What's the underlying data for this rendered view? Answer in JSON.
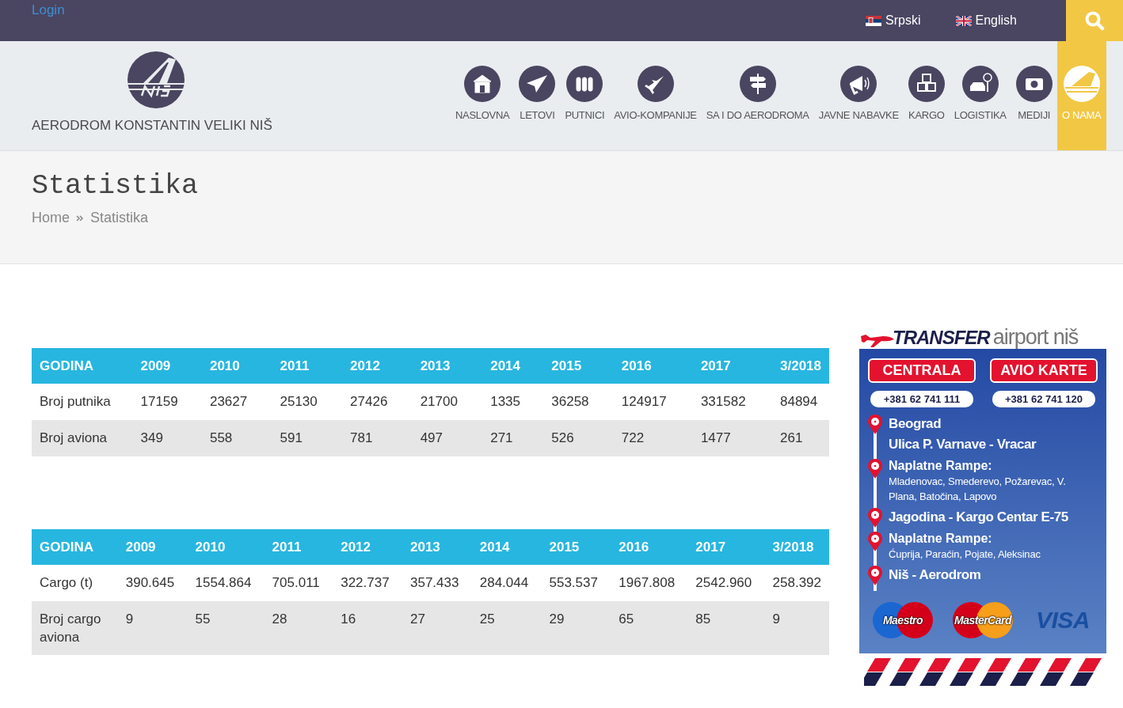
{
  "top_bar": {
    "login": "Login",
    "languages": [
      {
        "label": "Srpski"
      },
      {
        "label": "English"
      }
    ]
  },
  "header": {
    "site_name": "AERODROM KONSTANTIN VELIKI NIŠ",
    "nav": [
      {
        "label": "NASLOVNA",
        "selected": false
      },
      {
        "label": "LETOVI",
        "selected": false
      },
      {
        "label": "PUTNICI",
        "selected": false
      },
      {
        "label": "AVIO-KOMPANIJE",
        "selected": false
      },
      {
        "label": "SA I DO AERODROMA",
        "selected": false
      },
      {
        "label": "JAVNE NABAVKE",
        "selected": false
      },
      {
        "label": "KARGO",
        "selected": false
      },
      {
        "label": "LOGISTIKA",
        "selected": false
      },
      {
        "label": "MEDIJI",
        "selected": false
      },
      {
        "label": "O NAMA",
        "selected": true
      }
    ]
  },
  "page_header": {
    "title": "Statistika",
    "breadcrumb": [
      "Home",
      "Statistika"
    ]
  },
  "tables": [
    {
      "columns": [
        "GODINA",
        "2009",
        "2010",
        "2011",
        "2012",
        "2013",
        "2014",
        "2015",
        "2016",
        "2017",
        "3/2018"
      ],
      "rows": [
        [
          "Broj putnika",
          "17159",
          "23627",
          "25130",
          "27426",
          "21700",
          "1335",
          "36258",
          "124917",
          "331582",
          "84894"
        ],
        [
          "Broj aviona",
          "349",
          "558",
          "591",
          "781",
          "497",
          "271",
          "526",
          "722",
          "1477",
          "261"
        ]
      ]
    },
    {
      "columns": [
        "GODINA",
        "2009",
        "2010",
        "2011",
        "2012",
        "2013",
        "2014",
        "2015",
        "2016",
        "2017",
        "3/2018"
      ],
      "rows": [
        [
          "Cargo (t)",
          "390.645",
          "1554.864",
          "705.011",
          "322.737",
          "357.433",
          "284.044",
          "553.537",
          "1967.808",
          "2542.960",
          "258.392"
        ],
        [
          "Broj cargo aviona",
          "9",
          "55",
          "28",
          "16",
          "27",
          "25",
          "29",
          "65",
          "85",
          "9"
        ]
      ]
    }
  ],
  "ad": {
    "brand_bold": "TRANSFER",
    "brand_light": "airport niš",
    "contacts": [
      {
        "label": "CENTRALA",
        "phone": "+381 62 741 111"
      },
      {
        "label": "AVIO KARTE",
        "phone": "+381 62 741 120"
      }
    ],
    "stops": [
      {
        "kind": "place",
        "lines": [
          "Beograd",
          "Ulica P. Varnave - Vracar"
        ]
      },
      {
        "kind": "toll",
        "heading": "Naplatne Rampe:",
        "detail": "Mladenovac, Smederevo, Požarevac, V. Plana, Batočina, Lapovo"
      },
      {
        "kind": "place",
        "lines": [
          "Jagodina - Kargo Centar E-75"
        ]
      },
      {
        "kind": "toll",
        "heading": "Naplatne Rampe:",
        "detail": "Ćuprija, Paraćin, Pojate, Aleksinac"
      },
      {
        "kind": "place",
        "lines": [
          "Niš - Aerodrom"
        ]
      }
    ],
    "cards": [
      "Maestro",
      "MasterCard",
      "VISA"
    ]
  }
}
